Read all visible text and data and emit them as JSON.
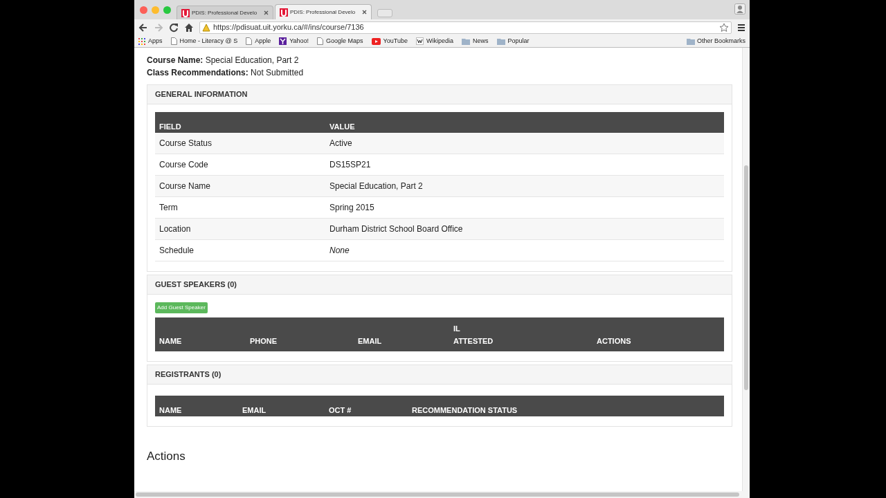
{
  "browser": {
    "tabs": [
      {
        "title": "PDIS: Professional Develo",
        "selected": false
      },
      {
        "title": "PDIS: Professional Develo",
        "selected": true
      }
    ],
    "url": "https://pdisuat.uit.yorku.ca/#/ins/course/7136",
    "bookmarks": [
      {
        "kind": "apps",
        "label": "Apps"
      },
      {
        "kind": "page",
        "label": "Home - Literacy @ S"
      },
      {
        "kind": "page",
        "label": "Apple"
      },
      {
        "kind": "yahoo",
        "label": "Yahoo!"
      },
      {
        "kind": "page",
        "label": "Google Maps"
      },
      {
        "kind": "youtube",
        "label": "YouTube"
      },
      {
        "kind": "wiki",
        "label": "Wikipedia"
      },
      {
        "kind": "folder",
        "label": "News"
      },
      {
        "kind": "folder",
        "label": "Popular"
      }
    ],
    "other_bookmarks": "Other Bookmarks"
  },
  "summary": [
    {
      "label": "Course Name:",
      "value": "Special Education, Part 2"
    },
    {
      "label": "Class Recommendations:",
      "value": "Not Submitted"
    }
  ],
  "general": {
    "title": "GENERAL INFORMATION",
    "columns": [
      "FIELD",
      "VALUE"
    ],
    "rows": [
      {
        "field": "Course Status",
        "value": "Active",
        "italic": false
      },
      {
        "field": "Course Code",
        "value": "DS15SP21",
        "italic": false
      },
      {
        "field": "Course Name",
        "value": "Special Education, Part 2",
        "italic": false
      },
      {
        "field": "Term",
        "value": "Spring 2015",
        "italic": false
      },
      {
        "field": "Location",
        "value": "Durham District School Board Office",
        "italic": false
      },
      {
        "field": "Schedule",
        "value": "None",
        "italic": true
      }
    ]
  },
  "guest_speakers": {
    "title": "GUEST SPEAKERS (0)",
    "button": "Add Guest Speaker",
    "columns": [
      "NAME",
      "PHONE",
      "EMAIL",
      "IL ATTESTED",
      "ACTIONS"
    ]
  },
  "registrants": {
    "title": "REGISTRANTS (0)",
    "columns": [
      "NAME",
      "EMAIL",
      "OCT #",
      "RECOMMENDATION STATUS"
    ]
  },
  "actions_heading": "Actions"
}
